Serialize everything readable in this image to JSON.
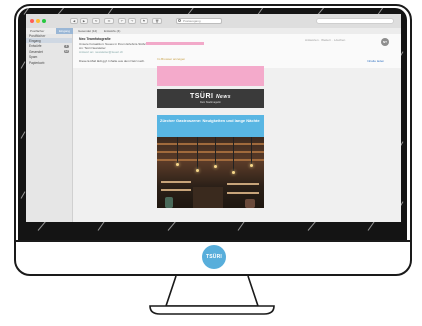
{
  "window": {
    "toolbar_buttons": [
      "◀",
      "▶",
      "⟲",
      "✉",
      "↶",
      "↷",
      "⚑",
      "🗑"
    ],
    "search_placeholder": "Postausgang"
  },
  "favorites": {
    "items": [
      "Postfächer",
      "Eingang",
      "Gesendet (12)",
      "Entwürfe (4)"
    ]
  },
  "sidebar": {
    "header": "Postfächer",
    "items": [
      {
        "label": "Eingang",
        "badge": ""
      },
      {
        "label": "Entwürfe",
        "badge": "4"
      },
      {
        "label": "Gesendet",
        "badge": "12"
      },
      {
        "label": "Spam",
        "badge": ""
      },
      {
        "label": "Papierkorb",
        "badge": ""
      }
    ]
  },
  "mail": {
    "sender": "Neo Teamfotografie",
    "subject": "Unsere Fotoaktion: Neues in Ihrem Erlebnis-Stübchen",
    "to": "An: Tsüri Newsletter",
    "reply_to": "Antwort an: newsletter@tsueri.ch",
    "remote_notice": "Diese E-Mail lädt ggf. Inhalte aus dem Netz nach.",
    "load_button": "Inhalte laden",
    "actions": "Antworten · Weiterl. · Löschen",
    "avatar_initials": "NT"
  },
  "newsletter": {
    "browser_link": "Im Browser anzeigen",
    "logo": "TSÜRI",
    "logo_suffix": "News",
    "logo_sub": "Dein Stadtmagazin",
    "headline": "Zürcher Gastroszene: Neuigkeiten und lange Nächte"
  },
  "monitor": {
    "logo_text": "TSÜRI"
  },
  "colors": {
    "accent_blue": "#58aedb",
    "pink": "#f4aacb",
    "news_blue": "#59b6e3"
  }
}
